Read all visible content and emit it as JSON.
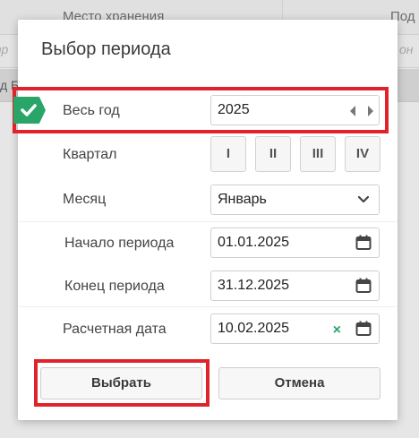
{
  "background": {
    "columns": [
      "Место хранения",
      "Под"
    ],
    "filter_left": "тр",
    "filter_right": "он",
    "row_text": "д Б"
  },
  "dialog": {
    "title": "Выбор периода",
    "year": {
      "label": "Весь год",
      "value": "2025"
    },
    "quarter": {
      "label": "Квартал",
      "options": [
        "I",
        "II",
        "III",
        "IV"
      ]
    },
    "month": {
      "label": "Месяц",
      "value": "Январь"
    },
    "period_start": {
      "label": "Начало периода",
      "value": "01.01.2025"
    },
    "period_end": {
      "label": "Конец периода",
      "value": "31.12.2025"
    },
    "calc_date": {
      "label": "Расчетная дата",
      "value": "10.02.2025",
      "clear_icon": "×"
    },
    "buttons": {
      "select": "Выбрать",
      "cancel": "Отмена"
    },
    "colors": {
      "accent": "#2aa56a",
      "highlight": "#e0232b"
    }
  }
}
